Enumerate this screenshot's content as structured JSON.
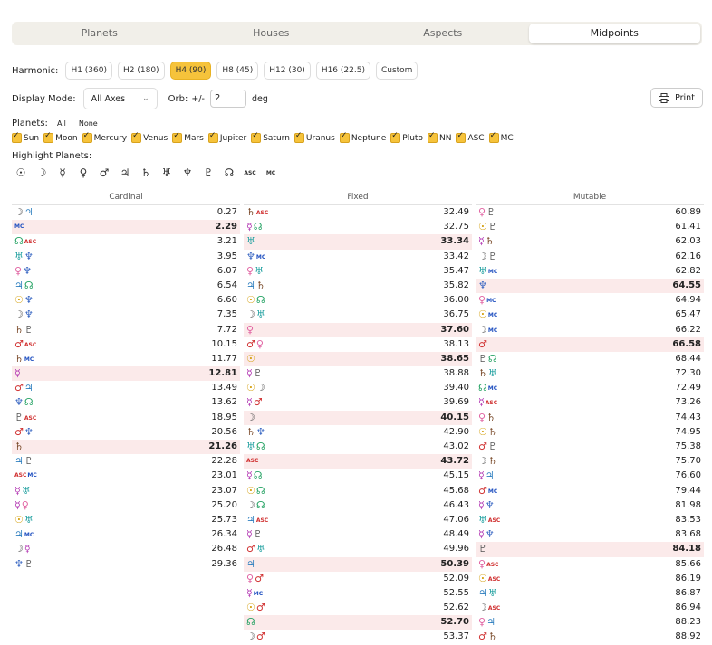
{
  "tabs": [
    "Planets",
    "Houses",
    "Aspects",
    "Midpoints"
  ],
  "active_tab": 3,
  "harmonic": {
    "label": "Harmonic:",
    "options": [
      "H1 (360)",
      "H2 (180)",
      "H4 (90)",
      "H8 (45)",
      "H12 (30)",
      "H16 (22.5)",
      "Custom"
    ],
    "active": 2
  },
  "display_mode": {
    "label": "Display Mode:",
    "value": "All Axes"
  },
  "orb": {
    "label": "Orb:",
    "prefix": "+/-",
    "value": "2",
    "unit": "deg"
  },
  "print_label": "Print",
  "planets_filter": {
    "label": "Planets:",
    "all": "All",
    "none": "None",
    "items": [
      "Sun",
      "Moon",
      "Mercury",
      "Venus",
      "Mars",
      "Jupiter",
      "Saturn",
      "Uranus",
      "Neptune",
      "Pluto",
      "NN",
      "ASC",
      "MC"
    ]
  },
  "highlight": {
    "label": "Highlight Planets:",
    "glyphs": [
      "☉",
      "☽",
      "☿",
      "♀",
      "♂",
      "♃",
      "♄",
      "♅",
      "♆",
      "♇",
      "☊",
      "ASC",
      "MC"
    ]
  },
  "glyph_colors": {
    "☉": "#d19a00",
    "☽": "#555555",
    "☿": "#b030b0",
    "♀": "#e060a0",
    "♂": "#d03030",
    "♃": "#3080c0",
    "♄": "#7a4a2a",
    "♅": "#20a0a0",
    "♆": "#3060c0",
    "♇": "#555555",
    "☊": "#20a060",
    "ASC": "#d03030",
    "MC": "#2050c0"
  },
  "columns": [
    {
      "title": "Cardinal",
      "rows": [
        {
          "pair": [
            "☽",
            "♃"
          ],
          "value": "0.27",
          "hi": false
        },
        {
          "pair": [
            "MC"
          ],
          "value": "2.29",
          "hi": true
        },
        {
          "pair": [
            "☊",
            "ASC"
          ],
          "value": "3.21",
          "hi": false
        },
        {
          "pair": [
            "♅",
            "♆"
          ],
          "value": "3.95",
          "hi": false
        },
        {
          "pair": [
            "♀",
            "♆"
          ],
          "value": "6.07",
          "hi": false
        },
        {
          "pair": [
            "♃",
            "☊"
          ],
          "value": "6.54",
          "hi": false
        },
        {
          "pair": [
            "☉",
            "♆"
          ],
          "value": "6.60",
          "hi": false
        },
        {
          "pair": [
            "☽",
            "♆"
          ],
          "value": "7.35",
          "hi": false
        },
        {
          "pair": [
            "♄",
            "♇"
          ],
          "value": "7.72",
          "hi": false
        },
        {
          "pair": [
            "♂",
            "ASC"
          ],
          "value": "10.15",
          "hi": false
        },
        {
          "pair": [
            "♄",
            "MC"
          ],
          "value": "11.77",
          "hi": false
        },
        {
          "pair": [
            "☿"
          ],
          "value": "12.81",
          "hi": true
        },
        {
          "pair": [
            "♂",
            "♃"
          ],
          "value": "13.49",
          "hi": false
        },
        {
          "pair": [
            "♆",
            "☊"
          ],
          "value": "13.62",
          "hi": false
        },
        {
          "pair": [
            "♇",
            "ASC"
          ],
          "value": "18.95",
          "hi": false
        },
        {
          "pair": [
            "♂",
            "♆"
          ],
          "value": "20.56",
          "hi": false
        },
        {
          "pair": [
            "♄"
          ],
          "value": "21.26",
          "hi": true
        },
        {
          "pair": [
            "♃",
            "♇"
          ],
          "value": "22.28",
          "hi": false
        },
        {
          "pair": [
            "ASC",
            "MC"
          ],
          "value": "23.01",
          "hi": false
        },
        {
          "pair": [
            "☿",
            "♅"
          ],
          "value": "23.07",
          "hi": false
        },
        {
          "pair": [
            "☿",
            "♀"
          ],
          "value": "25.20",
          "hi": false
        },
        {
          "pair": [
            "☉",
            "♅"
          ],
          "value": "25.73",
          "hi": false
        },
        {
          "pair": [
            "♃",
            "MC"
          ],
          "value": "26.34",
          "hi": false
        },
        {
          "pair": [
            "☽",
            "☿"
          ],
          "value": "26.48",
          "hi": false
        },
        {
          "pair": [
            "♆",
            "♇"
          ],
          "value": "29.36",
          "hi": false
        }
      ]
    },
    {
      "title": "Fixed",
      "rows": [
        {
          "pair": [
            "♄",
            "ASC"
          ],
          "value": "32.49",
          "hi": false
        },
        {
          "pair": [
            "☿",
            "☊"
          ],
          "value": "32.75",
          "hi": false
        },
        {
          "pair": [
            "♅"
          ],
          "value": "33.34",
          "hi": true
        },
        {
          "pair": [
            "♆",
            "MC"
          ],
          "value": "33.42",
          "hi": false
        },
        {
          "pair": [
            "♀",
            "♅"
          ],
          "value": "35.47",
          "hi": false
        },
        {
          "pair": [
            "♃",
            "♄"
          ],
          "value": "35.82",
          "hi": false
        },
        {
          "pair": [
            "☉",
            "☊"
          ],
          "value": "36.00",
          "hi": false
        },
        {
          "pair": [
            "☽",
            "♅"
          ],
          "value": "36.75",
          "hi": false
        },
        {
          "pair": [
            "♀"
          ],
          "value": "37.60",
          "hi": true
        },
        {
          "pair": [
            "♂",
            "♀"
          ],
          "value": "38.13",
          "hi": false
        },
        {
          "pair": [
            "☉"
          ],
          "value": "38.65",
          "hi": true
        },
        {
          "pair": [
            "☿",
            "♇"
          ],
          "value": "38.88",
          "hi": false
        },
        {
          "pair": [
            "☉",
            "☽"
          ],
          "value": "39.40",
          "hi": false
        },
        {
          "pair": [
            "☿",
            "♂"
          ],
          "value": "39.69",
          "hi": false
        },
        {
          "pair": [
            "☽"
          ],
          "value": "40.15",
          "hi": true
        },
        {
          "pair": [
            "♄",
            "♆"
          ],
          "value": "42.90",
          "hi": false
        },
        {
          "pair": [
            "♅",
            "☊"
          ],
          "value": "43.02",
          "hi": false
        },
        {
          "pair": [
            "ASC"
          ],
          "value": "43.72",
          "hi": true
        },
        {
          "pair": [
            "☿",
            "☊"
          ],
          "value": "45.15",
          "hi": false
        },
        {
          "pair": [
            "☉",
            "☊"
          ],
          "value": "45.68",
          "hi": false
        },
        {
          "pair": [
            "☽",
            "☊"
          ],
          "value": "46.43",
          "hi": false
        },
        {
          "pair": [
            "♃",
            "ASC"
          ],
          "value": "47.06",
          "hi": false
        },
        {
          "pair": [
            "☿",
            "♇"
          ],
          "value": "48.49",
          "hi": false
        },
        {
          "pair": [
            "♂",
            "♅"
          ],
          "value": "49.96",
          "hi": false
        },
        {
          "pair": [
            "♃"
          ],
          "value": "50.39",
          "hi": true
        },
        {
          "pair": [
            "♀",
            "♂"
          ],
          "value": "52.09",
          "hi": false
        },
        {
          "pair": [
            "☿",
            "MC"
          ],
          "value": "52.55",
          "hi": false
        },
        {
          "pair": [
            "☉",
            "♂"
          ],
          "value": "52.62",
          "hi": false
        },
        {
          "pair": [
            "☊"
          ],
          "value": "52.70",
          "hi": true
        },
        {
          "pair": [
            "☽",
            "♂"
          ],
          "value": "53.37",
          "hi": false
        }
      ]
    },
    {
      "title": "Mutable",
      "rows": [
        {
          "pair": [
            "♀",
            "♇"
          ],
          "value": "60.89",
          "hi": false
        },
        {
          "pair": [
            "☉",
            "♇"
          ],
          "value": "61.41",
          "hi": false
        },
        {
          "pair": [
            "☿",
            "♄"
          ],
          "value": "62.03",
          "hi": false
        },
        {
          "pair": [
            "☽",
            "♇"
          ],
          "value": "62.16",
          "hi": false
        },
        {
          "pair": [
            "♅",
            "MC"
          ],
          "value": "62.82",
          "hi": false
        },
        {
          "pair": [
            "♆"
          ],
          "value": "64.55",
          "hi": true
        },
        {
          "pair": [
            "♀",
            "MC"
          ],
          "value": "64.94",
          "hi": false
        },
        {
          "pair": [
            "☉",
            "MC"
          ],
          "value": "65.47",
          "hi": false
        },
        {
          "pair": [
            "☽",
            "MC"
          ],
          "value": "66.22",
          "hi": false
        },
        {
          "pair": [
            "♂"
          ],
          "value": "66.58",
          "hi": true
        },
        {
          "pair": [
            "♇",
            "☊"
          ],
          "value": "68.44",
          "hi": false
        },
        {
          "pair": [
            "♄",
            "♅"
          ],
          "value": "72.30",
          "hi": false
        },
        {
          "pair": [
            "☊",
            "MC"
          ],
          "value": "72.49",
          "hi": false
        },
        {
          "pair": [
            "☿",
            "ASC"
          ],
          "value": "73.26",
          "hi": false
        },
        {
          "pair": [
            "♀",
            "♄"
          ],
          "value": "74.43",
          "hi": false
        },
        {
          "pair": [
            "☉",
            "♄"
          ],
          "value": "74.95",
          "hi": false
        },
        {
          "pair": [
            "♂",
            "♇"
          ],
          "value": "75.38",
          "hi": false
        },
        {
          "pair": [
            "☽",
            "♄"
          ],
          "value": "75.70",
          "hi": false
        },
        {
          "pair": [
            "☿",
            "♃"
          ],
          "value": "76.60",
          "hi": false
        },
        {
          "pair": [
            "♂",
            "MC"
          ],
          "value": "79.44",
          "hi": false
        },
        {
          "pair": [
            "☿",
            "♆"
          ],
          "value": "81.98",
          "hi": false
        },
        {
          "pair": [
            "♅",
            "ASC"
          ],
          "value": "83.53",
          "hi": false
        },
        {
          "pair": [
            "☿",
            "♆"
          ],
          "value": "83.68",
          "hi": false
        },
        {
          "pair": [
            "♇"
          ],
          "value": "84.18",
          "hi": true
        },
        {
          "pair": [
            "♀",
            "ASC"
          ],
          "value": "85.66",
          "hi": false
        },
        {
          "pair": [
            "☉",
            "ASC"
          ],
          "value": "86.19",
          "hi": false
        },
        {
          "pair": [
            "♃",
            "♅"
          ],
          "value": "86.87",
          "hi": false
        },
        {
          "pair": [
            "☽",
            "ASC"
          ],
          "value": "86.94",
          "hi": false
        },
        {
          "pair": [
            "♀",
            "♃"
          ],
          "value": "88.23",
          "hi": false
        },
        {
          "pair": [
            "♂",
            "♄"
          ],
          "value": "88.92",
          "hi": false
        }
      ]
    }
  ]
}
